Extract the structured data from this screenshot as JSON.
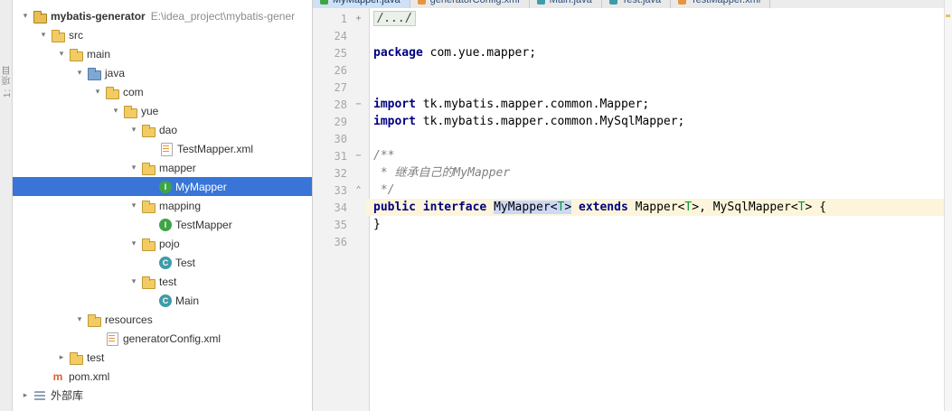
{
  "left_stripe": {
    "label": "1: 项目"
  },
  "tabs": {
    "items": [
      {
        "label": "MyMapper.java",
        "selected": true,
        "icon_color": "#3FA445"
      },
      {
        "label": "generatorConfig.xml",
        "selected": false,
        "icon_color": "#E8943A"
      },
      {
        "label": "Main.java",
        "selected": false,
        "icon_color": "#3D9CA8"
      },
      {
        "label": "Test.java",
        "selected": false,
        "icon_color": "#3D9CA8"
      },
      {
        "label": "TestMapper.xml",
        "selected": false,
        "icon_color": "#E8943A"
      }
    ]
  },
  "project_tree": {
    "rows": [
      {
        "level": 0,
        "chevron": "down",
        "icon": "project",
        "label": "mybatis-generator",
        "bold": true,
        "extra": "E:\\idea_project\\mybatis-gener"
      },
      {
        "level": 1,
        "chevron": "down",
        "icon": "folder",
        "label": "src"
      },
      {
        "level": 2,
        "chevron": "down",
        "icon": "folder",
        "label": "main"
      },
      {
        "level": 3,
        "chevron": "down",
        "icon": "folder-src",
        "label": "java"
      },
      {
        "level": 4,
        "chevron": "down",
        "icon": "folder",
        "label": "com"
      },
      {
        "level": 5,
        "chevron": "down",
        "icon": "folder",
        "label": "yue"
      },
      {
        "level": 6,
        "chevron": "down",
        "icon": "folder",
        "label": "dao"
      },
      {
        "level": 7,
        "chevron": "none",
        "icon": "xml",
        "label": "TestMapper.xml"
      },
      {
        "level": 6,
        "chevron": "down",
        "icon": "folder",
        "label": "mapper"
      },
      {
        "level": 7,
        "chevron": "none",
        "icon": "interface",
        "label": "MyMapper",
        "selected": true
      },
      {
        "level": 6,
        "chevron": "down",
        "icon": "folder",
        "label": "mapping"
      },
      {
        "level": 7,
        "chevron": "none",
        "icon": "interface",
        "label": "TestMapper"
      },
      {
        "level": 6,
        "chevron": "down",
        "icon": "folder",
        "label": "pojo"
      },
      {
        "level": 7,
        "chevron": "none",
        "icon": "class",
        "label": "Test"
      },
      {
        "level": 6,
        "chevron": "down",
        "icon": "folder",
        "label": "test"
      },
      {
        "level": 7,
        "chevron": "none",
        "icon": "class",
        "label": "Main"
      },
      {
        "level": 3,
        "chevron": "down",
        "icon": "folder-res",
        "label": "resources"
      },
      {
        "level": 4,
        "chevron": "none",
        "icon": "xml",
        "label": "generatorConfig.xml"
      },
      {
        "level": 2,
        "chevron": "right",
        "icon": "folder",
        "label": "test"
      },
      {
        "level": 1,
        "chevron": "none",
        "icon": "maven",
        "label": "pom.xml"
      },
      {
        "level": 0,
        "chevron": "right",
        "icon": "library",
        "label": "外部库"
      }
    ]
  },
  "editor": {
    "lines": [
      {
        "no": "1",
        "fold": "+",
        "segments": [
          {
            "t": "/.../",
            "c": "fold"
          }
        ]
      },
      {
        "no": "24",
        "segments": []
      },
      {
        "no": "25",
        "segments": [
          {
            "t": "package ",
            "c": "kw"
          },
          {
            "t": "com.yue.mapper;",
            "c": "pl"
          }
        ]
      },
      {
        "no": "26",
        "segments": []
      },
      {
        "no": "27",
        "segments": []
      },
      {
        "no": "28",
        "fold": "−",
        "segments": [
          {
            "t": "import ",
            "c": "kw"
          },
          {
            "t": "tk.mybatis.mapper.common.Mapper;",
            "c": "pl"
          }
        ]
      },
      {
        "no": "29",
        "segments": [
          {
            "t": "import ",
            "c": "kw"
          },
          {
            "t": "tk.mybatis.mapper.common.MySqlMapper;",
            "c": "pl"
          }
        ]
      },
      {
        "no": "30",
        "segments": []
      },
      {
        "no": "31",
        "fold": "−",
        "segments": [
          {
            "t": "/**",
            "c": "cm"
          }
        ]
      },
      {
        "no": "32",
        "segments": [
          {
            "t": " * 继承自己的MyMapper",
            "c": "cm"
          }
        ]
      },
      {
        "no": "33",
        "fold": "⌃",
        "segments": [
          {
            "t": " */",
            "c": "cm"
          }
        ]
      },
      {
        "no": "34",
        "current": true,
        "segments": [
          {
            "t": "public interface ",
            "c": "kw"
          },
          {
            "t": "MyMapper",
            "c": "pl id"
          },
          {
            "t": "<",
            "c": "pl id"
          },
          {
            "t": "T",
            "c": "tp id"
          },
          {
            "t": ">",
            "c": "pl id"
          },
          {
            "t": " ",
            "c": "pl"
          },
          {
            "t": "extends",
            "c": "kw"
          },
          {
            "t": " Mapper<",
            "c": "pl"
          },
          {
            "t": "T",
            "c": "tp"
          },
          {
            "t": ">, MySqlMapper<",
            "c": "pl"
          },
          {
            "t": "T",
            "c": "tp"
          },
          {
            "t": ">",
            "c": "pl"
          },
          {
            "t": " {",
            "c": "pl"
          }
        ]
      },
      {
        "no": "35",
        "segments": [
          {
            "t": "}",
            "c": "pl"
          }
        ]
      },
      {
        "no": "36",
        "segments": []
      }
    ]
  },
  "colors": {
    "selection_blue": "#3875D7",
    "keyword_navy": "#000080",
    "comment_gray": "#808080",
    "current_line_yellow": "#FCF5DB",
    "identifier_highlight": "#CCD8F6"
  }
}
